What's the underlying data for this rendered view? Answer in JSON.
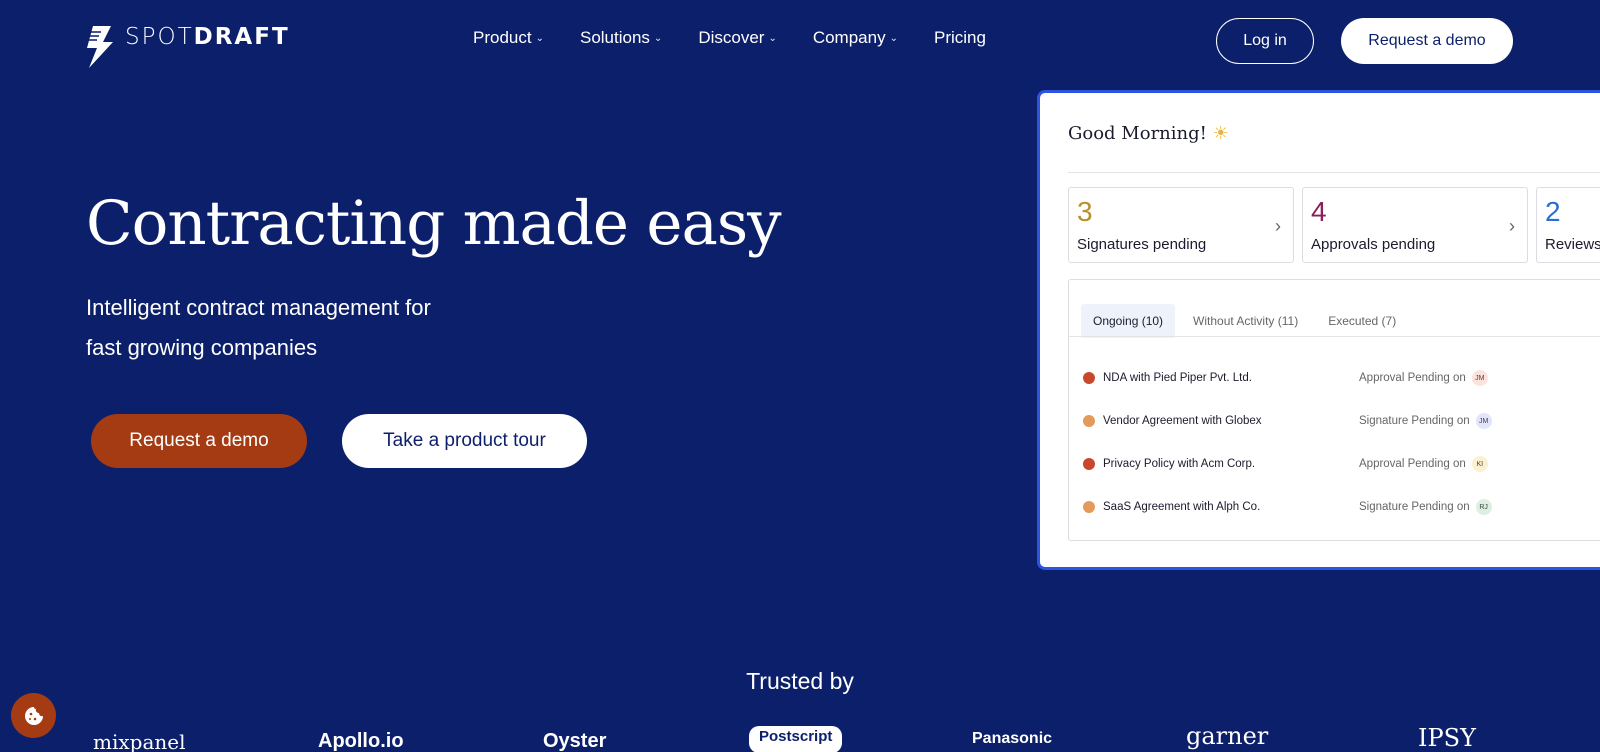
{
  "brand": {
    "name_light": "SPOT",
    "name_bold": "DRAFT"
  },
  "nav": {
    "items": [
      {
        "label": "Product",
        "has_dropdown": true
      },
      {
        "label": "Solutions",
        "has_dropdown": true
      },
      {
        "label": "Discover",
        "has_dropdown": true
      },
      {
        "label": "Company",
        "has_dropdown": true
      },
      {
        "label": "Pricing",
        "has_dropdown": false
      }
    ],
    "login": "Log in",
    "request_demo": "Request a demo"
  },
  "hero": {
    "title": "Contracting made easy",
    "subtitle_line1": "Intelligent contract management for",
    "subtitle_line2": "fast growing companies",
    "cta_primary": "Request a demo",
    "cta_secondary": "Take a product tour"
  },
  "dashboard": {
    "greeting": "Good Morning!",
    "greeting_icon": "☀",
    "stats": [
      {
        "count": "3",
        "label": "Signatures pending",
        "color": "#b8912b"
      },
      {
        "count": "4",
        "label": "Approvals pending",
        "color": "#8b1f57"
      },
      {
        "count": "2",
        "label": "Reviews",
        "color": "#2f6bd7"
      }
    ],
    "tabs": [
      "Ongoing (10)",
      "Without Activity (11)",
      "Executed (7)"
    ],
    "rows": [
      {
        "name": "NDA with Pied Piper Pvt. Ltd.",
        "status": "Approval Pending on",
        "initials": "JM",
        "dot_color": "#c9472c",
        "init_bg": "#fde2dc"
      },
      {
        "name": "Vendor Agreement with Globex",
        "status": "Signature Pending on",
        "initials": "JM",
        "dot_color": "#e39a5a",
        "init_bg": "#e1e4fb"
      },
      {
        "name": "Privacy Policy with Acm Corp.",
        "status": "Approval Pending on",
        "initials": "KI",
        "dot_color": "#c9472c",
        "init_bg": "#fbf0cf"
      },
      {
        "name": "SaaS Agreement with Alph Co.",
        "status": "Signature Pending on",
        "initials": "RJ",
        "dot_color": "#e39a5a",
        "init_bg": "#dcefe1"
      }
    ]
  },
  "trusted": {
    "heading": "Trusted by",
    "logos": [
      "mixpanel",
      "Apollo.io",
      "Oyster",
      "Postscript",
      "Panasonic",
      "garner",
      "IPSY"
    ]
  },
  "colors": {
    "background": "#0c1f6b",
    "accent": "#a43b13",
    "card_border": "#2c54e0"
  }
}
